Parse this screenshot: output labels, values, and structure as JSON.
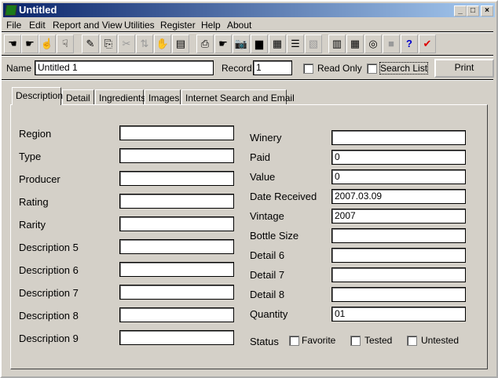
{
  "window": {
    "title": "Untitled",
    "minimize": "_",
    "maximize": "□",
    "close": "×"
  },
  "menu": [
    "File",
    "Edit",
    "Report and View",
    "Utilities",
    "Register",
    "Help",
    "About"
  ],
  "toolbar": [
    {
      "icon": "hand-left-icon",
      "glyph": "☚",
      "enabled": true
    },
    {
      "icon": "hand-right-icon",
      "glyph": "☛",
      "enabled": true
    },
    {
      "icon": "hand-up-icon",
      "glyph": "☝",
      "enabled": true
    },
    {
      "icon": "hand-down-icon",
      "glyph": "☟",
      "enabled": true
    },
    {
      "icon": "edit-record-icon",
      "glyph": "✎",
      "enabled": true
    },
    {
      "icon": "copy-record-icon",
      "glyph": "⎘",
      "enabled": true
    },
    {
      "icon": "cut-icon",
      "glyph": "✂",
      "enabled": false
    },
    {
      "icon": "sort-icon",
      "glyph": "⇅",
      "enabled": false
    },
    {
      "icon": "clear-icon",
      "glyph": "✋",
      "enabled": true
    },
    {
      "icon": "archive-icon",
      "glyph": "▤",
      "enabled": true
    },
    {
      "icon": "print-icon",
      "glyph": "⎙",
      "enabled": true
    },
    {
      "icon": "pointer-list-icon",
      "glyph": "☛",
      "enabled": true
    },
    {
      "icon": "camera-icon",
      "glyph": "📷",
      "enabled": true
    },
    {
      "icon": "bar-chart-icon",
      "glyph": "▆",
      "enabled": true
    },
    {
      "icon": "table-icon",
      "glyph": "▦",
      "enabled": true
    },
    {
      "icon": "list-icon",
      "glyph": "☰",
      "enabled": true
    },
    {
      "icon": "report-icon",
      "glyph": "▧",
      "enabled": false
    },
    {
      "icon": "calculator-icon",
      "glyph": "▥",
      "enabled": true
    },
    {
      "icon": "calendar-icon",
      "glyph": "▦",
      "enabled": true
    },
    {
      "icon": "cd-icon",
      "glyph": "◎",
      "enabled": true
    },
    {
      "icon": "save-icon",
      "glyph": "■",
      "enabled": false
    },
    {
      "icon": "help-icon",
      "glyph": "?",
      "enabled": true
    },
    {
      "icon": "check-icon",
      "glyph": "✔",
      "enabled": true
    }
  ],
  "namebar": {
    "name_label": "Name",
    "name_value": "Untitled 1",
    "record_label": "Record",
    "record_value": "1",
    "read_only": "Read Only",
    "search_list": "Search List",
    "print": "Print"
  },
  "tabs": [
    "Description",
    "Detail",
    "Ingredients",
    "Images",
    "Internet Search and Email"
  ],
  "left_fields": [
    {
      "label": "Region",
      "value": ""
    },
    {
      "label": "Type",
      "value": ""
    },
    {
      "label": "Producer",
      "value": ""
    },
    {
      "label": "Rating",
      "value": ""
    },
    {
      "label": "Rarity",
      "value": ""
    },
    {
      "label": "Description 5",
      "value": ""
    },
    {
      "label": "Description 6",
      "value": ""
    },
    {
      "label": "Description 7",
      "value": ""
    },
    {
      "label": "Description 8",
      "value": ""
    },
    {
      "label": "Description 9",
      "value": ""
    }
  ],
  "right_fields": [
    {
      "label": "Winery",
      "value": ""
    },
    {
      "label": "Paid",
      "value": "0"
    },
    {
      "label": "Value",
      "value": "0"
    },
    {
      "label": "Date Received",
      "value": "2007.03.09"
    },
    {
      "label": "Vintage",
      "value": "2007"
    },
    {
      "label": "Bottle Size",
      "value": ""
    },
    {
      "label": "Detail 6",
      "value": ""
    },
    {
      "label": "Detail 7",
      "value": ""
    },
    {
      "label": "Detail 8",
      "value": ""
    },
    {
      "label": "Quantity",
      "value": "01"
    }
  ],
  "status": {
    "label": "Status",
    "options": [
      "Favorite",
      "Tested",
      "Untested"
    ]
  }
}
